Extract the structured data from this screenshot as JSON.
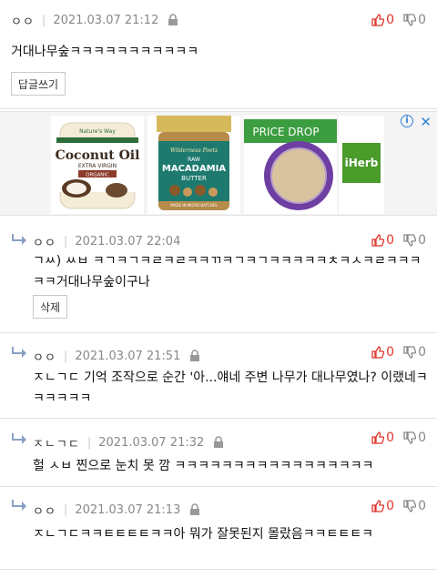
{
  "comments": [
    {
      "author": "ㅇㅇ",
      "date": "2021.03.07 21:12",
      "up": "0",
      "down": "0",
      "text": "거대나무숲ㅋㅋㅋㅋㅋㅋㅋㅋㅋㅋㅋ",
      "reply_btn": "답글쓰기"
    },
    {
      "author": "ㅇㅇ",
      "date": "2021.03.07 22:04",
      "up": "0",
      "down": "0",
      "text_line1": "ㄱㅆ) ㅆㅂ ㅋㄱㅋㄱㅋㄹㅋㄹㅋㅋㄲㅋㄱㅋㄱㅋㅋㅋㅋㅋㅊㅋㅅㅋㄹㅋㅋㅋ",
      "text_line2": "ㅋㅋ거대나무숲이구나",
      "delete_btn": "삭제"
    },
    {
      "author": "ㅇㅇ",
      "date": "2021.03.07 21:51",
      "up": "0",
      "down": "0",
      "text_line1": "ㅈㄴㄱㄷ 기억 조작으로 순간 '아...얘네 주변 나무가 대나무였나? 이랬네ㅋ",
      "text_line2": "ㅋㅋㅋㅋㅋ"
    },
    {
      "author": "ㅈㄴㄱㄷ",
      "date": "2021.03.07 21:32",
      "up": "0",
      "down": "0",
      "text": "헐 ㅅㅂ 찐으로 눈치 못 깜 ㅋㅋㅋㅋㅋㅋㅋㅋㅋㅋㅋㅋㅋㅋㅋㅋㅋ"
    },
    {
      "author": "ㅇㅇ",
      "date": "2021.03.07 21:13",
      "up": "0",
      "down": "0",
      "text": "ㅈㄴㄱㄷㅋㅋㅌㅌㅌㅌㅋㅋ아 뭐가 잘못된지 몰랐음ㅋㅋㅌㅌㅌㅋ"
    }
  ],
  "ad": {
    "coconut_brand": "Nature's Way",
    "coconut_title": "Coconut Oil",
    "coconut_sub": "EXTRA VIRGIN",
    "coconut_tag": "ORGANIC",
    "macadamia_brand": "Wilderness Poets",
    "macadamia_raw": "RAW",
    "macadamia_title": "MACADAMIA",
    "macadamia_sub": "BUTTER",
    "macadamia_note": "MADE IN MICRO BATCHES",
    "price_drop": "PRICE DROP",
    "iherb": "iHerb",
    "info": "i",
    "close": "✕"
  },
  "colors": {
    "accent_up": "#e0352b",
    "muted": "#888888",
    "ad_blue": "#2d82d6",
    "iherb_green": "#4b9b2b"
  },
  "icons": [
    "lock-icon",
    "thumbs-up-icon",
    "thumbs-down-icon",
    "reply-arrow-icon",
    "info-icon",
    "close-icon"
  ]
}
